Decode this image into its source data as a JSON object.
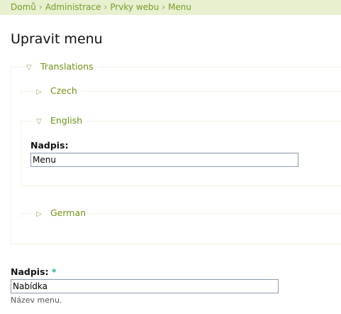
{
  "breadcrumb": {
    "items": [
      "Domů",
      "Administrace",
      "Prvky webu",
      "Menu"
    ],
    "separator": "›"
  },
  "page_title": "Upravit menu",
  "translations": {
    "legend": "Translations",
    "state": "expanded",
    "languages": [
      {
        "legend": "Czech",
        "state": "collapsed"
      },
      {
        "legend": "English",
        "state": "expanded",
        "field_label": "Nadpis:",
        "field_value": "Menu"
      },
      {
        "legend": "German",
        "state": "collapsed"
      }
    ]
  },
  "main_field": {
    "label": "Nadpis:",
    "required_marker": "*",
    "value": "Nabídka",
    "description": "Název menu."
  },
  "icons": {
    "expanded": "triangle-down-icon",
    "collapsed": "triangle-right-icon"
  },
  "colors": {
    "breadcrumb_bg": "#e7f0cf",
    "link_green": "#7a9b2a",
    "required": "#2bb39a"
  }
}
